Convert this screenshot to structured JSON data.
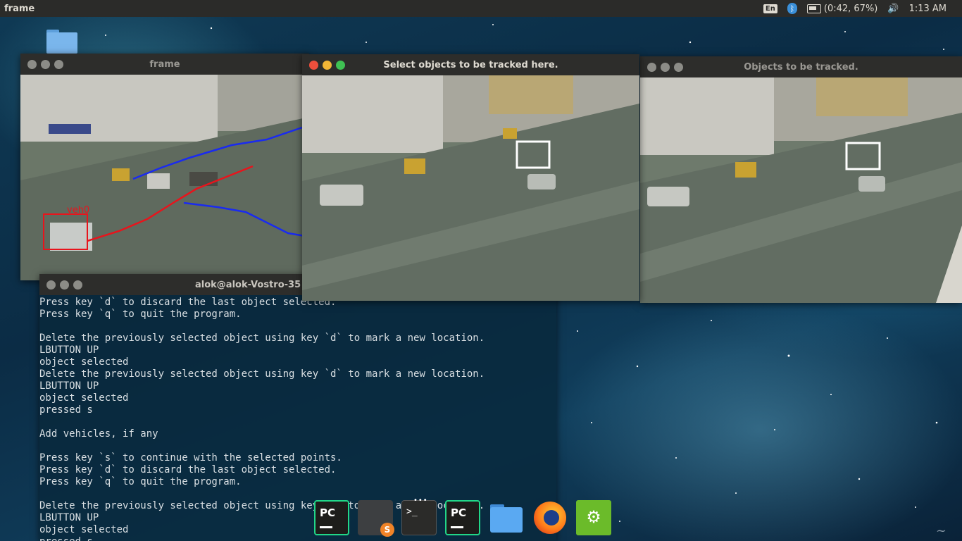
{
  "top_panel": {
    "app_name": "frame",
    "keyboard_layout": "En",
    "battery_text": "(0:42, 67%)",
    "clock": "1:13 AM"
  },
  "windows": {
    "frame": {
      "title": "frame",
      "label": "veh0"
    },
    "select": {
      "title": "Select objects to be tracked here."
    },
    "tracked": {
      "title": "Objects to be tracked."
    },
    "terminal": {
      "title": "alok@alok-Vostro-35"
    }
  },
  "terminal_lines": [
    "Press key `d` to discard the last object selected.",
    "Press key `q` to quit the program.",
    "",
    "Delete the previously selected object using key `d` to mark a new location.",
    "LBUTTON UP",
    "object selected",
    "Delete the previously selected object using key `d` to mark a new location.",
    "LBUTTON UP",
    "object selected",
    "pressed s",
    "",
    "Add vehicles, if any",
    "",
    "Press key `s` to continue with the selected points.",
    "Press key `d` to discard the last object selected.",
    "Press key `q` to quit the program.",
    "",
    "Delete the previously selected object using key `d` to mark a new location.",
    "LBUTTON UP",
    "object selected",
    "pressed s"
  ],
  "dock": {
    "pycharm_label": "PC",
    "sublime_badge": "S",
    "terminal_prompt": ">_",
    "running_indicator": "•••",
    "settings_glyph": "⚙"
  },
  "icons": {
    "bluetooth": "ᛒ",
    "volume": "🔊"
  },
  "colors": {
    "panel": "#2b2b29",
    "track_blue": "#1a2bf0",
    "track_red": "#e8141c",
    "selection_white": "#ffffff"
  }
}
